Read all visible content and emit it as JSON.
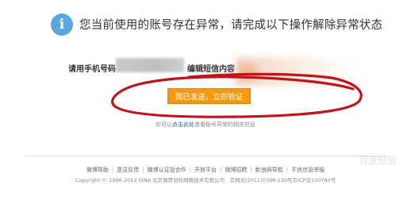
{
  "headline": "您当前使用的账号存在异常，请完成以下操作解除异常状态",
  "form": {
    "phone_label": "请用手机号码",
    "sms_label": "编辑短信内容"
  },
  "confirm_button": "我已发送，立即验证",
  "help": {
    "prefix": "你可以",
    "link": "点击此处",
    "suffix": "查看帐号异常的相关信息"
  },
  "footer": {
    "links": [
      "微博帮助",
      "意见反馈",
      "微博认证及合作",
      "开放平台",
      "微博招聘",
      "新浪网导航",
      "不良信息举报"
    ],
    "copyright": "Copyright © 1996-2012 SINA 北京微梦创科网络技术有限公司　京网文[2011]0398-130号京ICP证100780号"
  },
  "watermark": "百度经验",
  "colors": {
    "accent_orange": "#f39a12",
    "info_blue": "#5aa6de",
    "link_blue": "#1a66b3",
    "annotation_red": "#c0141c"
  },
  "icons": {
    "info": "info-circle-icon"
  }
}
